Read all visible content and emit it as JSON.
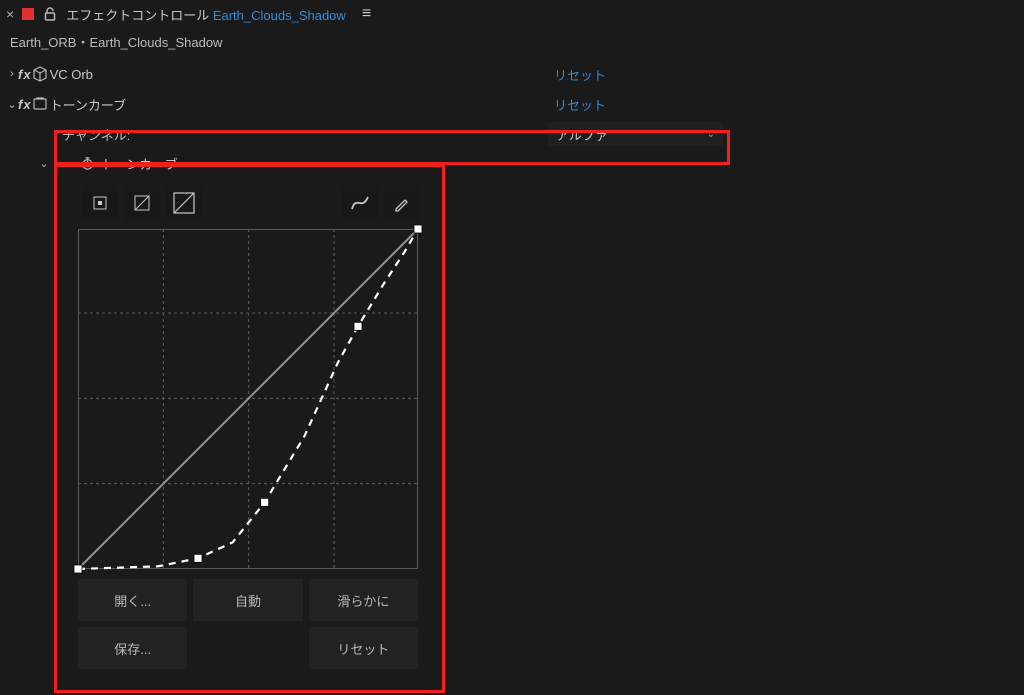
{
  "panel": {
    "title_prefix": "エフェクトコントロール",
    "title_link": "Earth_Clouds_Shadow",
    "breadcrumb": "Earth_ORB・Earth_Clouds_Shadow"
  },
  "effects": [
    {
      "name": "VC Orb",
      "reset": "リセット",
      "expanded": false
    },
    {
      "name": "トーンカーブ",
      "reset": "リセット",
      "expanded": true
    }
  ],
  "channel": {
    "label": "チャンネル:",
    "value": "アルファ"
  },
  "tonecurve": {
    "label": "トーンカーブ",
    "buttons": {
      "open": "開く...",
      "auto": "自動",
      "smooth": "滑らかに",
      "save": "保存...",
      "reset": "リセット"
    }
  },
  "chart_data": {
    "type": "line",
    "title": "",
    "xlabel": "",
    "ylabel": "",
    "xlim": [
      0,
      255
    ],
    "ylim": [
      0,
      255
    ],
    "gridlines": [
      0,
      64,
      128,
      192,
      255
    ],
    "series": [
      {
        "name": "reference-linear",
        "style": "solid",
        "color": "#a38e83",
        "points": [
          [
            0,
            0
          ],
          [
            255,
            255
          ]
        ]
      },
      {
        "name": "alpha-curve",
        "style": "dashed",
        "color": "#ffffff",
        "points": [
          [
            0,
            0
          ],
          [
            30,
            1
          ],
          [
            60,
            2
          ],
          [
            90,
            8
          ],
          [
            116,
            20
          ],
          [
            140,
            50
          ],
          [
            170,
            100
          ],
          [
            195,
            155
          ],
          [
            210,
            182
          ],
          [
            230,
            215
          ],
          [
            245,
            238
          ],
          [
            255,
            255
          ]
        ]
      }
    ],
    "control_points": [
      [
        0,
        0
      ],
      [
        90,
        8
      ],
      [
        140,
        50
      ],
      [
        210,
        182
      ],
      [
        255,
        255
      ]
    ]
  },
  "colors": {
    "accent_link": "#2e8bd6",
    "highlight_frame": "#f02020",
    "curve_ref": "#a38e83"
  }
}
